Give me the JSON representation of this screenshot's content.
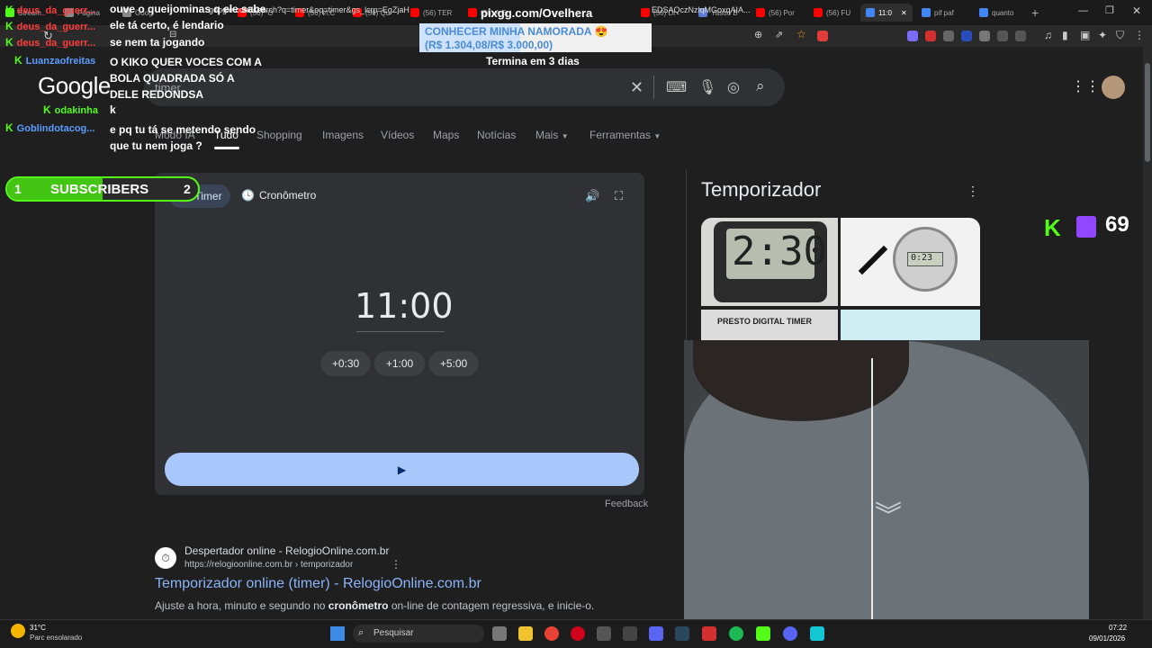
{
  "browser": {
    "tabs": [
      {
        "label": "Stream",
        "color": "#53fc18"
      },
      {
        "label": "Página",
        "color": "#888"
      },
      {
        "label": "Goog",
        "color": "#888"
      },
      {
        "label": "(56) \"O",
        "color": "#ff0000"
      },
      {
        "label": "(56) И.С",
        "color": "#ff0000"
      },
      {
        "label": "(56) Qu",
        "color": "#ff0000"
      },
      {
        "label": "(56) TER",
        "color": "#ff0000"
      },
      {
        "label": "(56) A Er",
        "color": "#ff0000"
      },
      {
        "label": "(56) Dr",
        "color": "#ff0000"
      },
      {
        "label": "Yasuo B",
        "color": "#5b7bd5"
      },
      {
        "label": "(56) Por",
        "color": "#ff0000"
      },
      {
        "label": "(56) FU",
        "color": "#ff0000"
      },
      {
        "label": "11:0",
        "color": "#4285f4"
      },
      {
        "label": "pif paf",
        "color": "#4285f4"
      },
      {
        "label": "quanto",
        "color": "#4285f4"
      }
    ],
    "url": "google.com/search?q=timer&oq=timer&gs_lcrp=EgZjaH",
    "url_tail": "EDSAQczNzlqMGoxqAIA..."
  },
  "google": {
    "logo": "Google",
    "search_value": "timer",
    "nav_tabs": [
      "Modo IA",
      "Tudo",
      "Shopping",
      "Imagens",
      "Vídeos",
      "Maps",
      "Notícias",
      "Mais",
      "Ferramentas"
    ]
  },
  "timer": {
    "tab_timer": "Timer",
    "tab_stopwatch": "Cronômetro",
    "time": "11:00",
    "add_buttons": [
      "+0:30",
      "+1:00",
      "+5:00"
    ],
    "feedback": "Feedback"
  },
  "result": {
    "site_name": "Despertador online - RelogioOnline.com.br",
    "url": "https://relogioonline.com.br › temporizador",
    "title": "Temporizador online (timer) - RelogioOnline.com.br",
    "snippet_plain": "Ajuste a hora, minuto e segundo no ",
    "snippet_bold": "cronômetro",
    "snippet_tail": " on-line de contagem regressiva, e inicie-o."
  },
  "knowledge_panel": {
    "title": "Temporizador",
    "image1_text": "2:30",
    "image2_text": "0:23",
    "image3_text": "PRESTO  DIGITAL TIMER"
  },
  "stream_overlay": {
    "pix_url": "pixgg.com/Ovelhera",
    "pix_line1": "CONHECER MINHA NAMORADA 😍",
    "pix_line2": "(R$ 1.304,08/R$ 3.000,00)",
    "pix_ends": "Termina em 3 dias",
    "pix_progress": 0.4347,
    "subs_label": "SUBSCRIBERS",
    "subs_current": "1",
    "subs_goal": "2",
    "subs_progress": 0.5,
    "viewers": "69",
    "chat": [
      {
        "user": "deus_da_guerr...",
        "user_color": "#ff3b3b",
        "msg": "ouve o queijominas q ele sabe"
      },
      {
        "user": "deus_da_guerr...",
        "user_color": "#ff3b3b",
        "msg": "ele tá certo, é lendario"
      },
      {
        "user": "deus_da_guerr...",
        "user_color": "#ff3b3b",
        "msg": "se nem ta jogando"
      },
      {
        "user": "Luanzaofreitas",
        "user_color": "#5c9dff",
        "msg": "O KIKO QUER VOCES COM A BOLA QUADRADA SÓ A DELE REDONDSA"
      },
      {
        "user": "odakinha",
        "user_color": "#53fc18",
        "msg": "k"
      },
      {
        "user": "Goblindotacog...",
        "user_color": "#5c9dff",
        "msg": "e pq tu tá se metendo sendo que tu nem joga ?"
      }
    ]
  },
  "taskbar": {
    "weather_temp": "31°C",
    "weather_desc": "Parc ensolarado",
    "search_placeholder": "Pesquisar",
    "time": "07:22",
    "date": "09/01/2026"
  }
}
